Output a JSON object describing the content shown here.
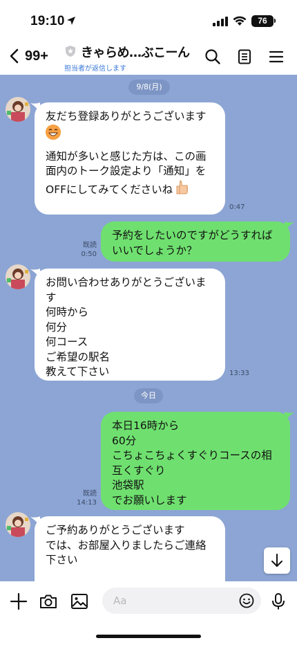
{
  "status_bar": {
    "time": "19:10",
    "battery": "76"
  },
  "header": {
    "back_count": "99+",
    "title": "きゃらめ…ぶこーん",
    "subtitle": "担当者が返信します"
  },
  "messages": [
    {
      "date": "9/8(月)"
    },
    {
      "side": "in",
      "lines": [
        "友だち登録ありがとうございます",
        "",
        "",
        "通知が多いと感じた方は、この画",
        "面内のトーク設定より「通知」を",
        "OFFにしてみてくださいね"
      ],
      "time": "0:47"
    },
    {
      "side": "out",
      "text": "予約をしたいのですがどうすれば\nいいでしょうか？",
      "read": "既読",
      "time": "0:50"
    },
    {
      "side": "in",
      "text": "お問い合わせありがとうございま\nす\n何時から\n何分\n何コース\nご希望の駅名\n教えて下さい",
      "time": "13:33"
    },
    {
      "date": "今日"
    },
    {
      "side": "out",
      "text": "本日16時から\n60分\nこちょこちょくすぐりコースの相\n互くすぐり\n池袋駅\nでお願いします",
      "read": "既読",
      "time": "14:13"
    },
    {
      "side": "in",
      "text": "ご予約ありがとうございます\nでは、お部屋入りましたらご連絡\n下さい"
    }
  ],
  "input": {
    "placeholder": "Aa"
  },
  "colors": {
    "chat_bg": "#8ca5d4",
    "out_bubble": "#6fe06f",
    "in_bubble": "#ffffff",
    "link": "#3a78d9"
  },
  "icons": [
    "location-arrow-icon",
    "signal-icon",
    "wifi-icon",
    "battery-icon",
    "back-chevron-icon",
    "shield-icon",
    "search-icon",
    "notes-icon",
    "menu-icon",
    "scroll-down-icon",
    "plus-icon",
    "camera-icon",
    "image-icon",
    "smile-icon",
    "mic-icon"
  ]
}
